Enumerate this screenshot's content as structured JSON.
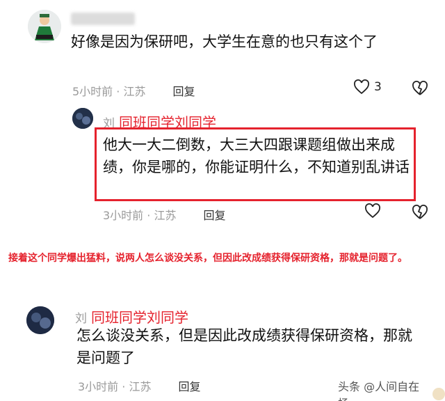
{
  "comment1": {
    "text": "好像是因为保研吧，大学生在意的也只有这个了",
    "time_location": "5小时前 · 江苏",
    "reply_label": "回复",
    "like_count": "3"
  },
  "comment2": {
    "surname": "刘",
    "label": "同班同学刘同学",
    "text": "他大一大二倒数，大三大四跟课题组做出来成绩，你是哪的，你能证明什么，不知道别乱讲话",
    "time_location": "3小时前 · 江苏",
    "reply_label": "回复"
  },
  "note": {
    "text": "接着这个同学爆出猛料，说两人怎么谈没关系，但因此改成绩获得保研资格，那就是问题了。"
  },
  "comment3": {
    "surname": "刘",
    "label": "同班同学刘同学",
    "text": "怎么谈没关系，但是因此改成绩获得保研资格，那就是问题了",
    "time_location": "3小时前 · 江苏",
    "reply_label": "回复"
  },
  "watermark": {
    "text": "头条 @人间自在扬"
  },
  "colors": {
    "accent_red": "#e5222d",
    "meta_gray": "#9a9a9a"
  }
}
